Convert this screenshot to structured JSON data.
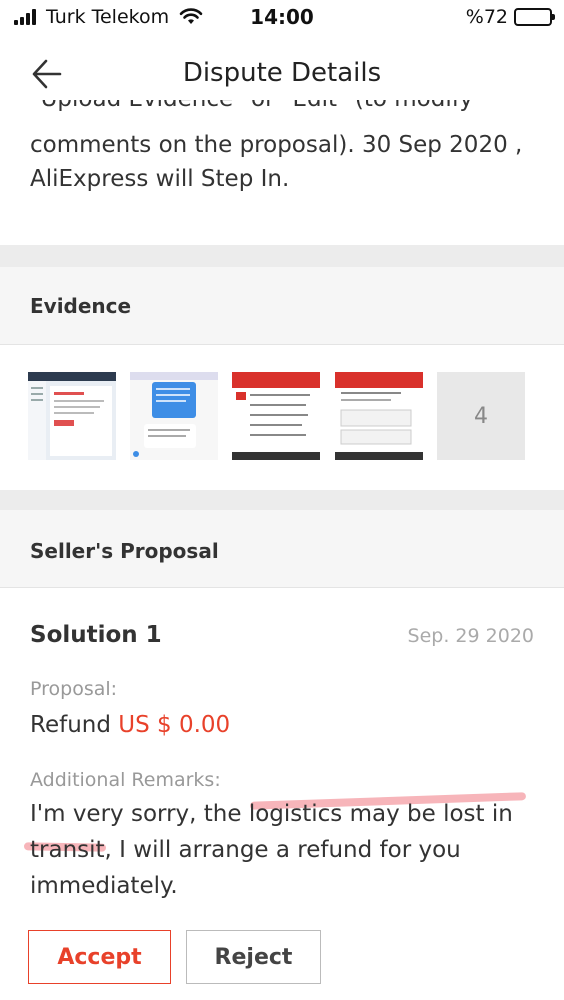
{
  "status_bar": {
    "carrier": "Turk Telekom",
    "time": "14:00",
    "battery_percent": "%72",
    "battery_level": 0.72
  },
  "header": {
    "title": "Dispute Details",
    "back_icon": "arrow-left-icon"
  },
  "intro": {
    "cut_line": "\"Upload Evidence\" or \"Edit\" (to modify",
    "text": "comments on the proposal). 30 Sep 2020 , AliExpress will Step In."
  },
  "evidence": {
    "heading": "Evidence",
    "more_count": "4"
  },
  "proposal_section": {
    "heading": "Seller's Proposal",
    "solution_title": "Solution 1",
    "date": "Sep. 29 2020",
    "proposal_label": "Proposal:",
    "refund_label": "Refund",
    "refund_amount": "US $ 0.00",
    "remarks_label": "Additional Remarks:",
    "remarks_text": "I'm very sorry, the logistics may be lost in transit, I will arrange a refund for you immediately.",
    "accept_label": "Accept",
    "reject_label": "Reject"
  },
  "colors": {
    "accent": "#e8412a",
    "highlight": "#f07882"
  }
}
